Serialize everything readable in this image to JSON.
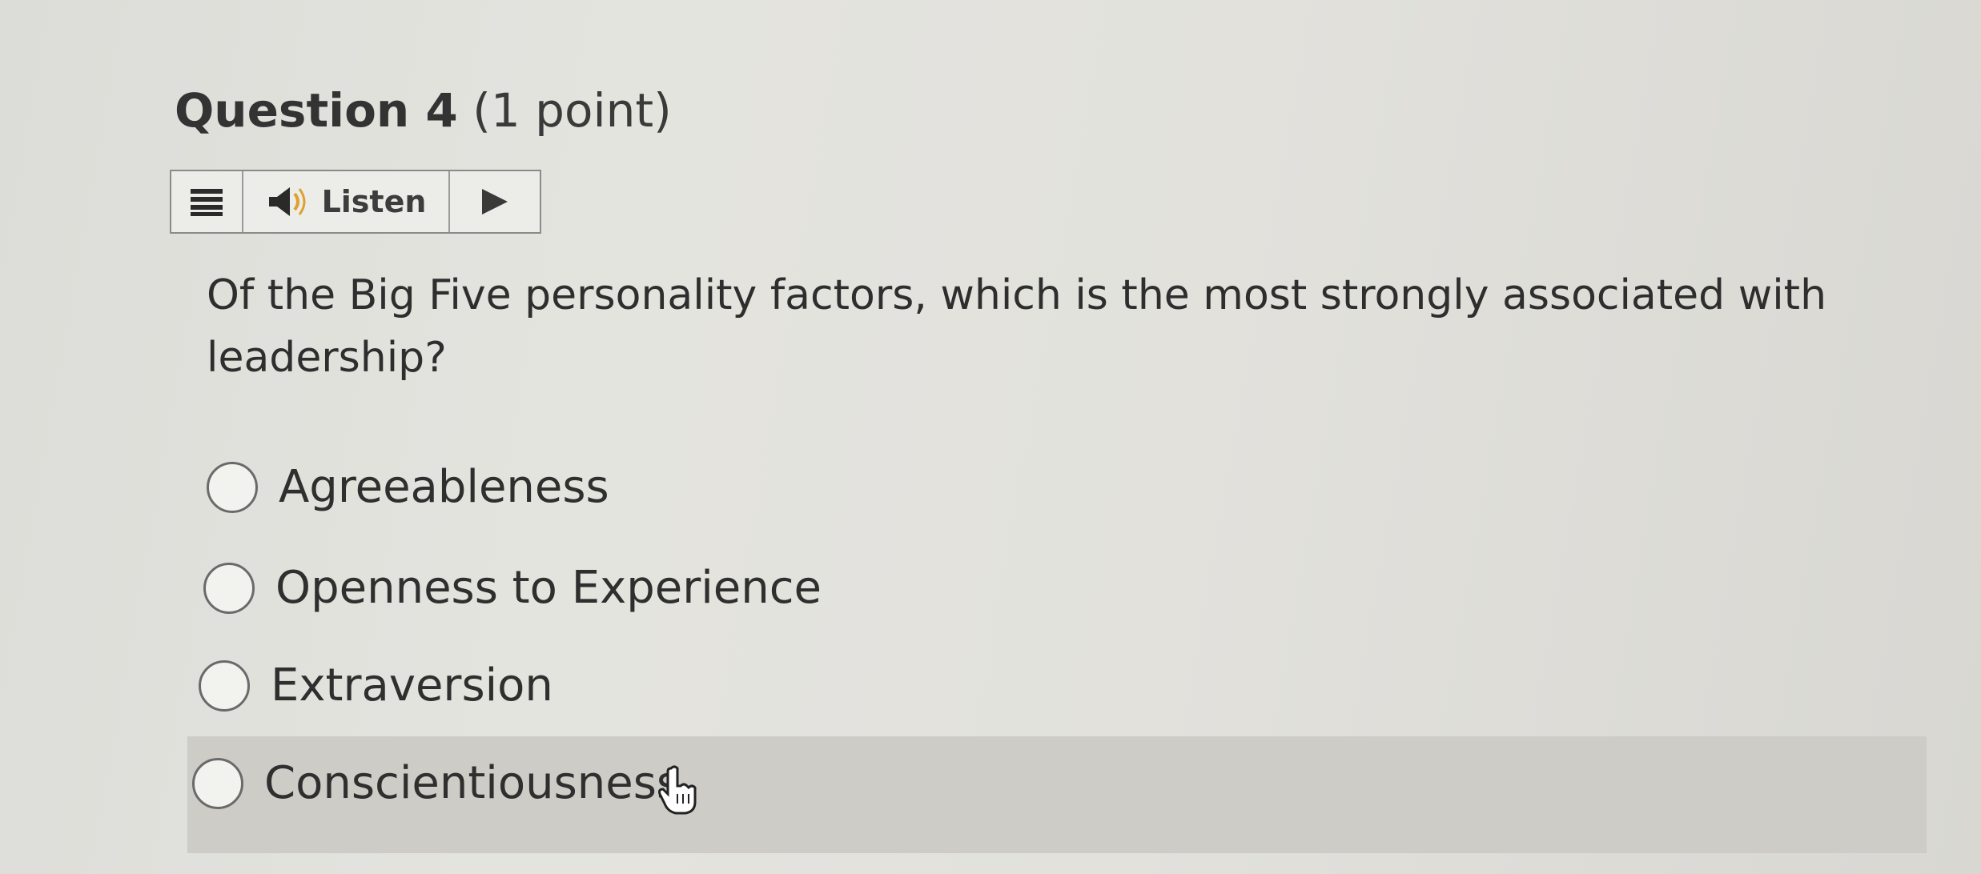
{
  "question": {
    "number_label": "Question 4",
    "points_label": "(1 point)",
    "text": "Of the Big Five personality factors, which is the most strongly associated with leadership?"
  },
  "listen_bar": {
    "menu_icon": "menu-icon",
    "speaker_icon": "speaker-icon",
    "listen_label": "Listen",
    "play_icon": "play-icon"
  },
  "options": [
    {
      "label": "Agreeableness",
      "selected": false
    },
    {
      "label": "Openness to Experience",
      "selected": false
    },
    {
      "label": "Extraversion",
      "selected": false
    },
    {
      "label": "Conscientiousness",
      "selected": false,
      "hovered": true
    }
  ],
  "cursor": "hand-pointer-icon"
}
